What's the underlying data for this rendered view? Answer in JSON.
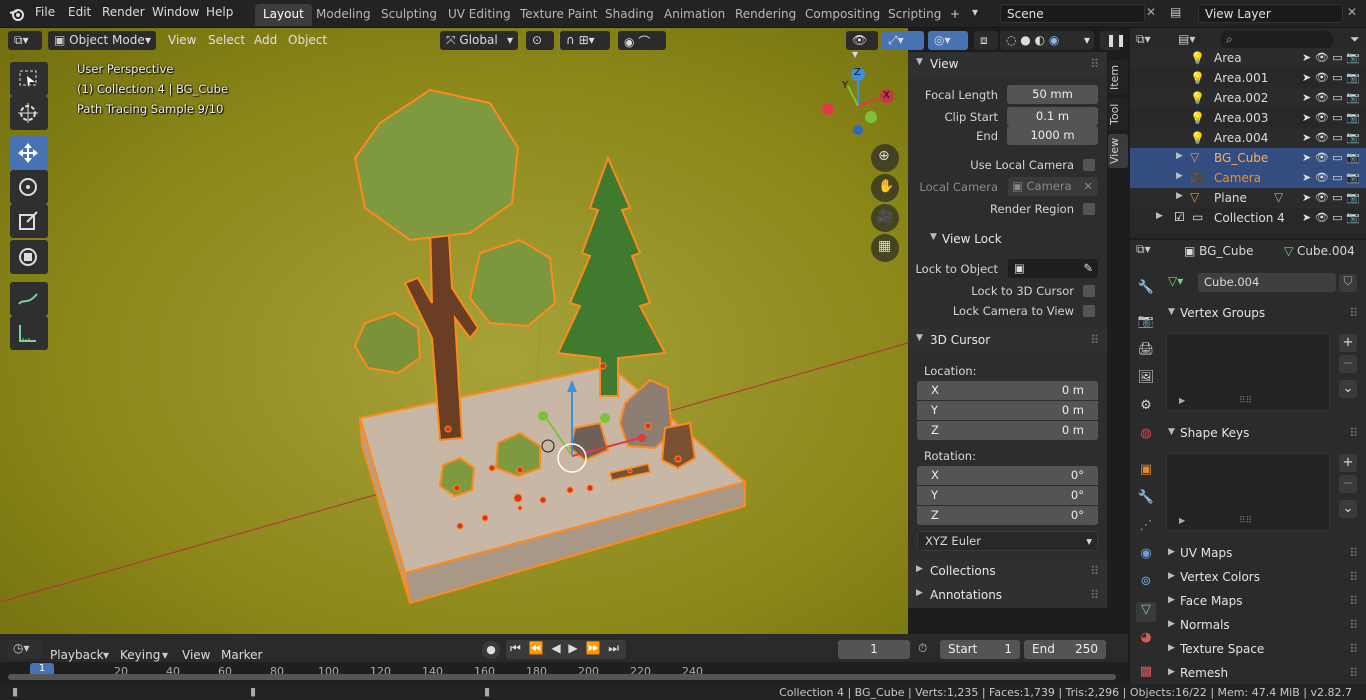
{
  "topbar": {
    "menus": [
      "File",
      "Edit",
      "Render",
      "Window",
      "Help"
    ],
    "workspaces": [
      "Layout",
      "Modeling",
      "Sculpting",
      "UV Editing",
      "Texture Paint",
      "Shading",
      "Animation",
      "Rendering",
      "Compositing",
      "Scripting"
    ],
    "active_workspace": "Layout",
    "add_tab": "+",
    "scene_label": "Scene",
    "view_layer_label": "View Layer"
  },
  "viewport_header": {
    "mode": "Object Mode",
    "menus": [
      "View",
      "Select",
      "Add",
      "Object"
    ],
    "orientation": "Global"
  },
  "viewport_overlay": {
    "line1": "User Perspective",
    "line2": "(1) Collection 4 | BG_Cube",
    "line3": "Path Tracing Sample 9/10"
  },
  "gizmo": {
    "x": "X",
    "y": "Y",
    "z": "Z"
  },
  "npanel": {
    "tabs": [
      "Item",
      "Tool",
      "View"
    ],
    "active_tab": "View",
    "view": {
      "title": "View",
      "focal_length_label": "Focal Length",
      "focal_length": "50 mm",
      "clip_start_label": "Clip Start",
      "clip_start": "0.1 m",
      "end_label": "End",
      "end": "1000 m",
      "use_local_camera": "Use Local Camera",
      "local_camera_label": "Local Camera",
      "local_camera_value": "Camera",
      "render_region": "Render Region"
    },
    "view_lock": {
      "title": "View Lock",
      "lock_to_object": "Lock to Object",
      "lock_to_cursor": "Lock to 3D Cursor",
      "lock_camera": "Lock Camera to View"
    },
    "cursor": {
      "title": "3D Cursor",
      "location_label": "Location:",
      "location": [
        {
          "k": "X",
          "v": "0 m"
        },
        {
          "k": "Y",
          "v": "0 m"
        },
        {
          "k": "Z",
          "v": "0 m"
        }
      ],
      "rotation_label": "Rotation:",
      "rotation": [
        {
          "k": "X",
          "v": "0°"
        },
        {
          "k": "Y",
          "v": "0°"
        },
        {
          "k": "Z",
          "v": "0°"
        }
      ],
      "rotation_mode": "XYZ Euler"
    },
    "collections": "Collections",
    "annotations": "Annotations"
  },
  "outliner": {
    "rows": [
      {
        "name": "Area",
        "kind": "light"
      },
      {
        "name": "Area.001",
        "kind": "light"
      },
      {
        "name": "Area.002",
        "kind": "light"
      },
      {
        "name": "Area.003",
        "kind": "light"
      },
      {
        "name": "Area.004",
        "kind": "light"
      },
      {
        "name": "BG_Cube",
        "kind": "mesh"
      },
      {
        "name": "Camera",
        "kind": "camera"
      },
      {
        "name": "Plane",
        "kind": "mesh"
      },
      {
        "name": "Collection 4",
        "kind": "collection"
      }
    ]
  },
  "properties": {
    "object_name": "BG_Cube",
    "mesh_name": "Cube.004",
    "data_field": "Cube.004",
    "panels_open": [
      "Vertex Groups",
      "Shape Keys"
    ],
    "panels_closed": [
      "UV Maps",
      "Vertex Colors",
      "Face Maps",
      "Normals",
      "Texture Space",
      "Remesh"
    ]
  },
  "timeline": {
    "menus": [
      "Playback",
      "Keying",
      "View",
      "Marker"
    ],
    "current_frame": "1",
    "start_label": "Start",
    "start": "1",
    "end_label": "End",
    "end": "250",
    "ruler": [
      "1",
      "20",
      "40",
      "60",
      "80",
      "100",
      "120",
      "140",
      "160",
      "180",
      "200",
      "220",
      "240"
    ]
  },
  "status": "Collection 4 | BG_Cube | Verts:1,235 | Faces:1,739 | Tris:2,296 | Objects:16/22 | Mem: 47.4 MiB | v2.82.7",
  "colors": {
    "accent": "#4772b3",
    "selection": "#334d80",
    "outline": "#ff8a1c",
    "ground": "#7a7a10"
  }
}
